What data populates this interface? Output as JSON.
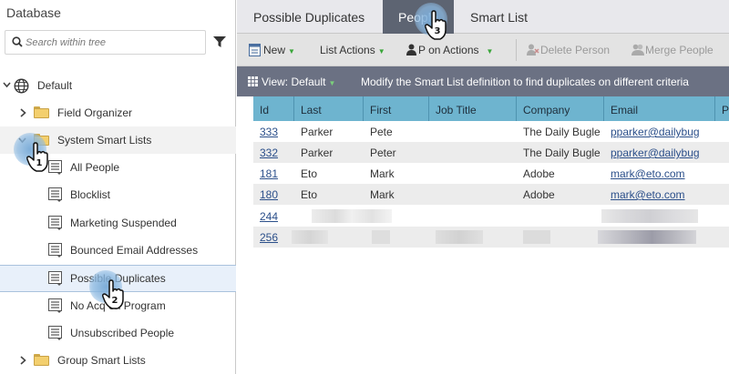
{
  "sidebar": {
    "title": "Database",
    "search_placeholder": "Search within tree",
    "items": [
      {
        "label": "Default"
      },
      {
        "label": "Field Organizer"
      },
      {
        "label": "System Smart Lists"
      },
      {
        "label": "All People"
      },
      {
        "label": "Blocklist"
      },
      {
        "label": "Marketing Suspended"
      },
      {
        "label": "Bounced Email Addresses"
      },
      {
        "label": "Possible Duplicates"
      },
      {
        "label": "No Acquisition Program",
        "display": "No Acq     on Program"
      },
      {
        "label": "Unsubscribed People"
      },
      {
        "label": "Group Smart Lists"
      }
    ]
  },
  "tabs": [
    {
      "label": "Possible Duplicates"
    },
    {
      "label": "People"
    },
    {
      "label": "Smart List"
    }
  ],
  "toolbar": {
    "new": "New",
    "list_actions": "List Actions",
    "person_actions": "P      on Actions",
    "delete_person": "Delete Person",
    "merge_people": "Merge People"
  },
  "viewbar": {
    "view": "View: Default",
    "hint": "Modify the Smart List definition to find duplicates on different criteria"
  },
  "grid": {
    "columns": [
      "Id",
      "Last",
      "First",
      "Job Title",
      "Company",
      "Email",
      "Pl"
    ],
    "rows": [
      {
        "id": "333",
        "last": "Parker",
        "first": "Pete",
        "job": "",
        "company": "The Daily Bugle",
        "email": "pparker@dailybug"
      },
      {
        "id": "332",
        "last": "Parker",
        "first": "Peter",
        "job": "",
        "company": "The Daily Bugle",
        "email": "pparker@dailybug"
      },
      {
        "id": "181",
        "last": "Eto",
        "first": "Mark",
        "job": "",
        "company": "Adobe",
        "email": "mark@eto.com"
      },
      {
        "id": "180",
        "last": "Eto",
        "first": "Mark",
        "job": "",
        "company": "Adobe",
        "email": "mark@eto.com"
      },
      {
        "id": "244",
        "last": "",
        "first": "",
        "job": "",
        "company": "",
        "email": ""
      },
      {
        "id": "256",
        "last": "",
        "first": "",
        "job": "",
        "company": "",
        "email": ""
      }
    ]
  },
  "markers": [
    {
      "number": "1"
    },
    {
      "number": "2"
    },
    {
      "number": "3"
    }
  ],
  "colors": {
    "active_tab": "#5d6472",
    "viewbar": "#6b7183",
    "grid_header": "#6eb4cf",
    "link": "#2b4f8a",
    "caret_green": "#3aa63a"
  }
}
